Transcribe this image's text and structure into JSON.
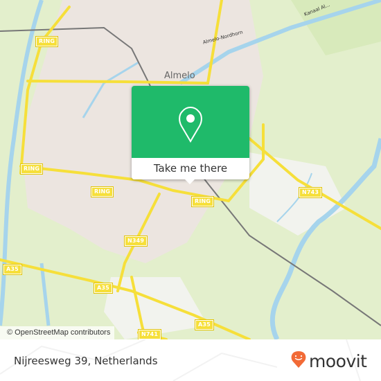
{
  "map": {
    "place_labels": {
      "city": "Almelo"
    },
    "street_labels": {
      "almelo_nordhorn": "Almelo-Nordhorn",
      "kanaal": "Kanaal Al..."
    },
    "road_shields": [
      {
        "id": "ring-nw",
        "label": "RING"
      },
      {
        "id": "ring-w",
        "label": "RING"
      },
      {
        "id": "ring-sw",
        "label": "RING"
      },
      {
        "id": "ring-s",
        "label": "RING"
      },
      {
        "id": "n349",
        "label": "N349"
      },
      {
        "id": "n743",
        "label": "N743"
      },
      {
        "id": "a35-w",
        "label": "A35"
      },
      {
        "id": "a35-c",
        "label": "A35"
      },
      {
        "id": "a35-e",
        "label": "A35"
      },
      {
        "id": "n741",
        "label": "N741"
      }
    ],
    "attribution": "© OpenStreetMap contributors",
    "colors": {
      "land": "#e3efcc",
      "urban": "#ebe4e0",
      "water": "#a6d4ec",
      "road": "#f6df3a"
    }
  },
  "popup": {
    "icon": "map-pin-icon",
    "button_label": "Take me there",
    "accent": "#1fba6a"
  },
  "footer": {
    "address": "Nijreesweg 39, Netherlands",
    "brand": "moovit",
    "brand_color": "#f26a36"
  }
}
